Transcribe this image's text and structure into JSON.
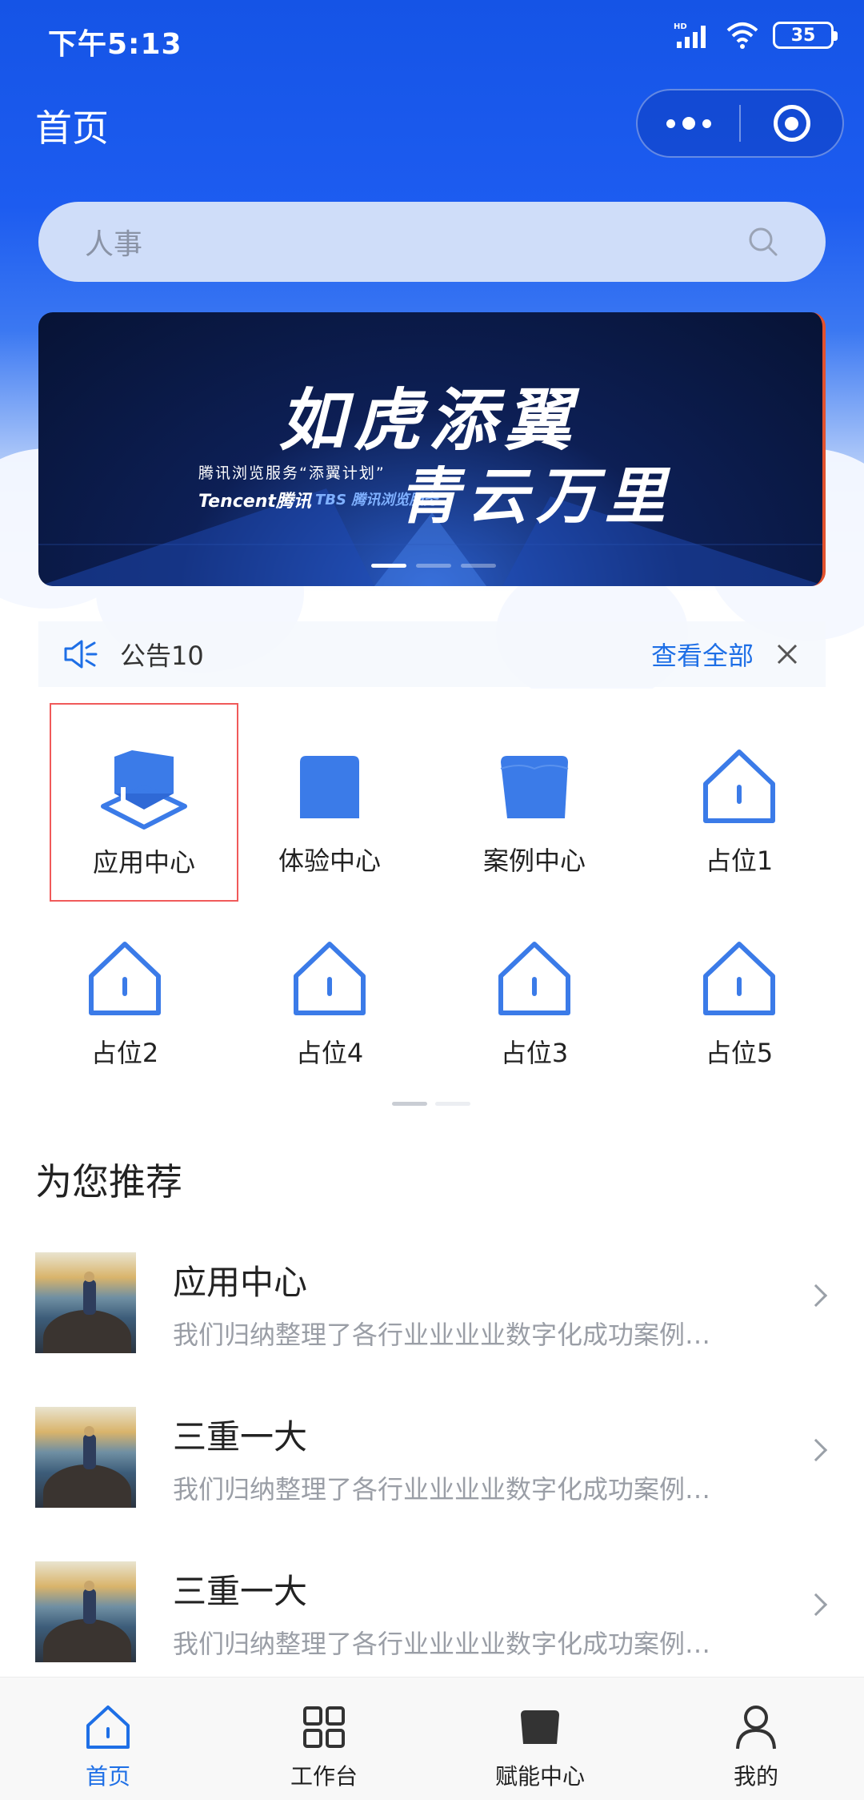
{
  "status_bar": {
    "time": "下午5:13",
    "battery": "35",
    "network": "HD"
  },
  "nav": {
    "title": "首页"
  },
  "search": {
    "placeholder": "人事"
  },
  "banner": {
    "title_line1": "如虎添翼",
    "title_line2": "青云万里",
    "subtitle": "腾讯浏览服务“添翼计划”",
    "brand": "Tencent腾讯",
    "brand2": "TBS 腾讯浏览服务"
  },
  "notice": {
    "text": "公告10",
    "view_all": "查看全部"
  },
  "grid": {
    "items": [
      {
        "label": "应用中心",
        "icon": "cube-icon",
        "selected": true
      },
      {
        "label": "体验中心",
        "icon": "box-icon"
      },
      {
        "label": "案例中心",
        "icon": "folder-icon"
      },
      {
        "label": "占位1",
        "icon": "home-icon"
      },
      {
        "label": "占位2",
        "icon": "home-icon"
      },
      {
        "label": "占位4",
        "icon": "home-icon"
      },
      {
        "label": "占位3",
        "icon": "home-icon"
      },
      {
        "label": "占位5",
        "icon": "home-icon"
      }
    ]
  },
  "recommend": {
    "title": "为您推荐",
    "items": [
      {
        "title": "应用中心",
        "desc": "我们归纳整理了各行业业业业数字化成功案例…"
      },
      {
        "title": "三重一大",
        "desc": "我们归纳整理了各行业业业业数字化成功案例…"
      },
      {
        "title": "三重一大",
        "desc": "我们归纳整理了各行业业业业数字化成功案例…"
      }
    ]
  },
  "tabbar": {
    "items": [
      {
        "label": "首页",
        "icon": "home-icon",
        "active": true
      },
      {
        "label": "工作台",
        "icon": "grid-icon"
      },
      {
        "label": "赋能中心",
        "icon": "box-icon"
      },
      {
        "label": "我的",
        "icon": "user-icon"
      }
    ]
  },
  "colors": {
    "primary": "#1e6fe6",
    "header": "#1554e6",
    "selected_border": "#f05a5a"
  }
}
